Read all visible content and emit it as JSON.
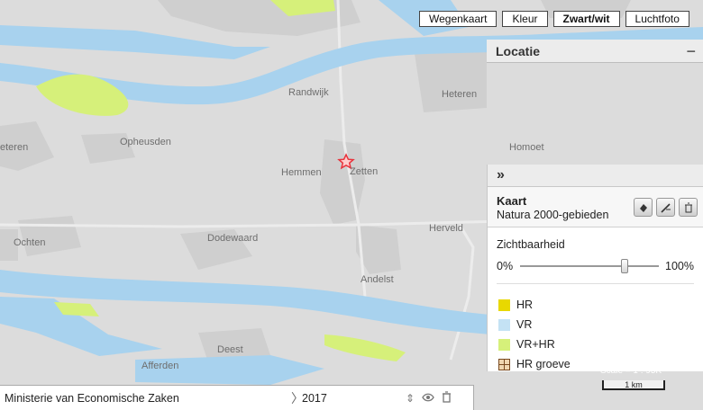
{
  "map_types": [
    "Wegenkaart",
    "Kleur",
    "Zwart/wit",
    "Luchtfoto"
  ],
  "active_map_type": "Zwart/wit",
  "places": {
    "heteren": "Heteren",
    "randwijk": "Randwijk",
    "opheusden": "Opheusden",
    "homoet": "Homoet",
    "hemmen": "Hemmen",
    "zetten": "Zetten",
    "eteren": "eteren",
    "dodewaard": "Dodewaard",
    "herveld": "Herveld",
    "ochten": "Ochten",
    "andelst": "Andelst",
    "deest": "Deest",
    "afferden": "Afferden"
  },
  "location_panel": {
    "title": "Locatie",
    "collapse": "−"
  },
  "layer_panel": {
    "expand": "»",
    "kaart_title": "Kaart",
    "kaart_subtitle": "Natura 2000-gebieden",
    "visibility_label": "Zichtbaarheid",
    "visibility_min": "0%",
    "visibility_max": "100%",
    "visibility_value": 0.75
  },
  "legend": [
    {
      "label": "HR",
      "color": "#e8d800"
    },
    {
      "label": "VR",
      "color": "#c4e2f4"
    },
    {
      "label": "VR+HR",
      "color": "#d6f07a"
    },
    {
      "label": "HR groeve",
      "color": "#f0d6b0"
    }
  ],
  "bottom_bar": {
    "organization": "Ministerie van Economische Zaken",
    "chevron": "〉",
    "year": "2017"
  },
  "scale": {
    "text": "Scale = 1 : 95K",
    "bar_label": "1 km"
  },
  "colors": {
    "map_background": "#dcdcdc",
    "water": "#a8d2ee",
    "natura_vr_hr": "#d6f07a",
    "marker": "#e8333c"
  },
  "icons": {
    "marker": "star-marker-icon",
    "edit": "eraser-icon",
    "magic": "wand-icon",
    "delete": "trash-icon",
    "reorder": "up-down-arrows-icon",
    "visibility": "eye-icon"
  }
}
